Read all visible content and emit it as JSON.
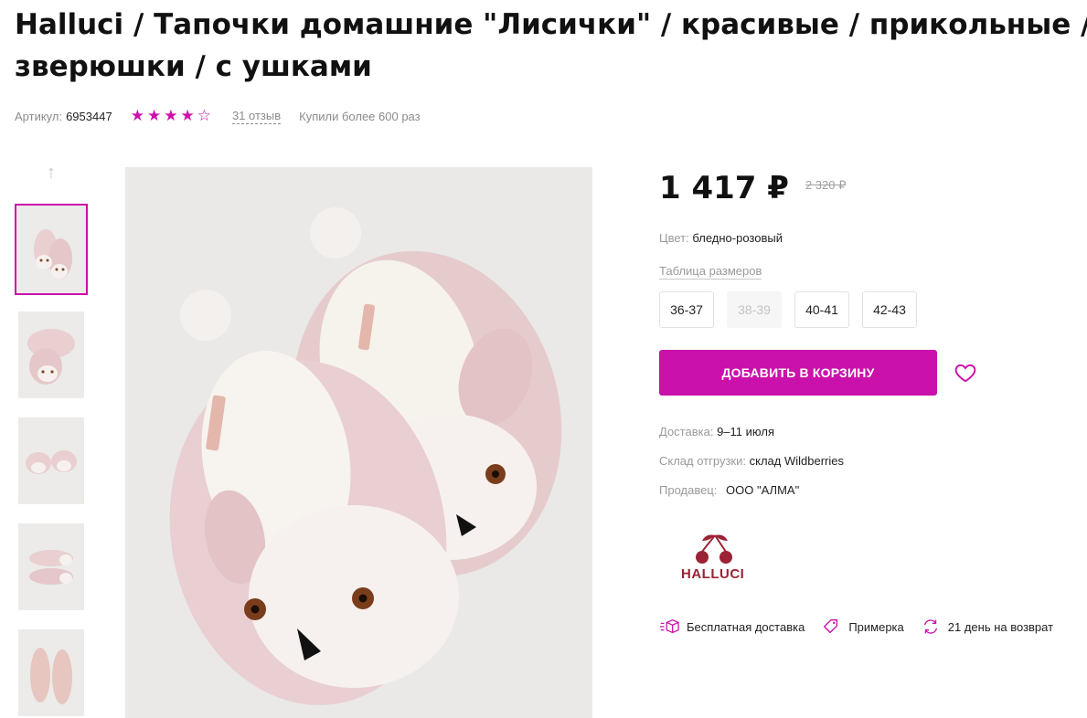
{
  "product": {
    "title": "Halluci / Тапочки домашние \"Лисички\" / красивые / прикольные / зверюшки / с ушками",
    "article_label": "Артикул:",
    "article_value": "6953447",
    "rating": 4,
    "rating_max": 5,
    "reviews": "31 отзыв",
    "bought": "Купили более 600 раз"
  },
  "gallery": {
    "thumb_count": 5,
    "active_index": 0
  },
  "pricing": {
    "price": "1 417 ₽",
    "old_price": "2 320 ₽"
  },
  "details": {
    "color_label": "Цвет:",
    "color_value": "бледно-розовый",
    "size_table": "Таблица размеров",
    "sizes": [
      "36-37",
      "38-39",
      "40-41",
      "42-43"
    ],
    "cart_button": "ДОБАВИТЬ В КОРЗИНУ",
    "delivery_label": "Доставка:",
    "delivery_value": "9–11 июля",
    "warehouse_label": "Склад отгрузки:",
    "warehouse_value": "склад Wildberries",
    "seller_label": "Продавец:",
    "seller_value": "ООО \"АЛМА\"",
    "brand": "HALLUCI"
  },
  "features": {
    "free_delivery": "Бесплатная доставка",
    "fitting": "Примерка",
    "return": "21 день на возврат"
  },
  "colors": {
    "accent": "#cb11ab",
    "brand_red": "#9b2335"
  }
}
